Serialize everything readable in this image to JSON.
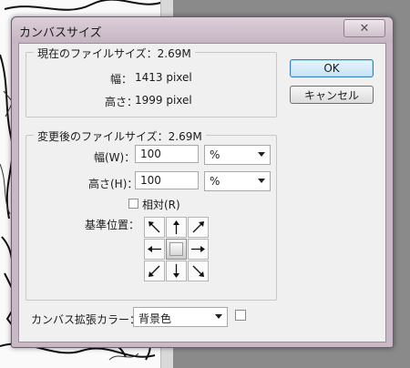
{
  "dialog": {
    "title": "カンバスサイズ",
    "close_glyph": "✕"
  },
  "current": {
    "legend": "現在のファイルサイズ：2.69M",
    "width_label": "幅：",
    "width_value": "1413 pixel",
    "height_label": "高さ：",
    "height_value": "1999 pixel"
  },
  "new_size": {
    "legend": "変更後のファイルサイズ：2.69M",
    "width_label": "幅(W)：",
    "width_value": "100",
    "width_unit": "%",
    "height_label": "高さ(H)：",
    "height_value": "100",
    "height_unit": "%",
    "relative_label": "相対(R)",
    "relative_checked": false,
    "anchor_label": "基準位置："
  },
  "anchor": {
    "selected": "center",
    "cells": [
      "arrow-up-left-icon",
      "arrow-up-icon",
      "arrow-up-right-icon",
      "arrow-left-icon",
      "anchor-center",
      "arrow-right-icon",
      "arrow-down-left-icon",
      "arrow-down-icon",
      "arrow-down-right-icon"
    ]
  },
  "buttons": {
    "ok": "OK",
    "cancel": "キャンセル"
  },
  "extension_color": {
    "label": "カンバス拡張カラー：",
    "value": "背景色",
    "swatch_color": "#ffffff"
  }
}
